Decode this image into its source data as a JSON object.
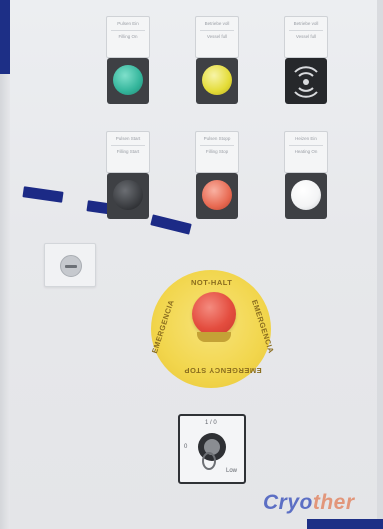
{
  "panel": {
    "buttons": [
      {
        "label_top": "Pulsen Ein",
        "label_bottom": "Filling On",
        "lens_color": "#33b59b"
      },
      {
        "label_top": "Betriebe voll",
        "label_bottom": "Vessel full",
        "lens_color": "#e4dc37"
      },
      {
        "label_top": "Betriebe voll",
        "label_bottom": "Vessel full",
        "lens_color": "#2d2f33"
      },
      {
        "label_top": "Pulsen Start",
        "label_bottom": "Filling Start",
        "lens_color": "#34363a"
      },
      {
        "label_top": "Pulsen Stopp",
        "label_bottom": "Filling Stop",
        "lens_color": "#e86a52"
      },
      {
        "label_top": "Heizen Ein",
        "label_bottom": "Heating On",
        "lens_color": "#f3f4f5"
      }
    ],
    "estop": {
      "top_text": "NOT-HALT",
      "left_text": "EMERGENCIA",
      "right_text": "EMERGENCIA",
      "bottom_text": "EMERGENCY STOP",
      "ring_color": "#f2d64d",
      "mushroom_color": "#e44d3f"
    },
    "selector_switch": {
      "top_label": "1 / 0",
      "left_label": "0",
      "right_label": "Low"
    },
    "logo": {
      "part_a": "Cryo",
      "part_b": "ther"
    },
    "accent_color": "#1d2f86"
  }
}
